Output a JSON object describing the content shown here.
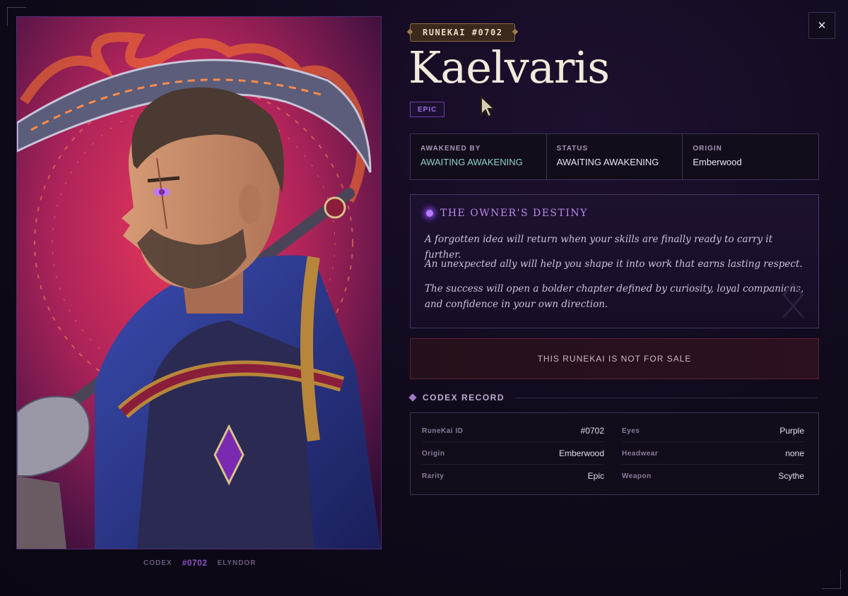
{
  "badge": "RUNEKAI #0702",
  "title": "Kaelvaris",
  "rarity_tag": "EPIC",
  "close_glyph": "✕",
  "info": [
    {
      "label": "AWAKENED BY",
      "value": "AWAITING AWAKENING"
    },
    {
      "label": "STATUS",
      "value": "AWAITING AWAKENING"
    },
    {
      "label": "ORIGIN",
      "value": "Emberwood"
    }
  ],
  "destiny": {
    "title": "THE OWNER'S DESTINY",
    "paragraphs": [
      "A forgotten idea will return when your skills are finally ready to carry it further.",
      "An unexpected ally will help you shape it into work that earns lasting respect.",
      "The success will open a bolder chapter defined by curiosity, loyal companions, and confidence in your own direction."
    ]
  },
  "not_for_sale": "THIS RUNEKAI IS NOT FOR SALE",
  "codex": {
    "heading": "CODEX RECORD",
    "rows_left": [
      {
        "key": "RuneKai ID",
        "value": "#0702"
      },
      {
        "key": "Origin",
        "value": "Emberwood"
      },
      {
        "key": "Rarity",
        "value": "Epic"
      }
    ],
    "rows_right": [
      {
        "key": "Eyes",
        "value": "Purple"
      },
      {
        "key": "Headwear",
        "value": "none"
      },
      {
        "key": "Weapon",
        "value": "Scythe"
      }
    ]
  },
  "caption": {
    "left": "CODEX",
    "number": "#0702",
    "right": "ELYNDOR"
  },
  "colors": {
    "background": "#110a1c",
    "accent_purple": "#a06ee0",
    "teal_status": "#8fd4c6",
    "badge_gold": "#8a6a44",
    "not_for_sale_red": "#5a2233"
  },
  "icons": [
    "close-icon",
    "destiny-orb-icon",
    "codex-diamond-icon",
    "pointer-cursor-icon"
  ]
}
